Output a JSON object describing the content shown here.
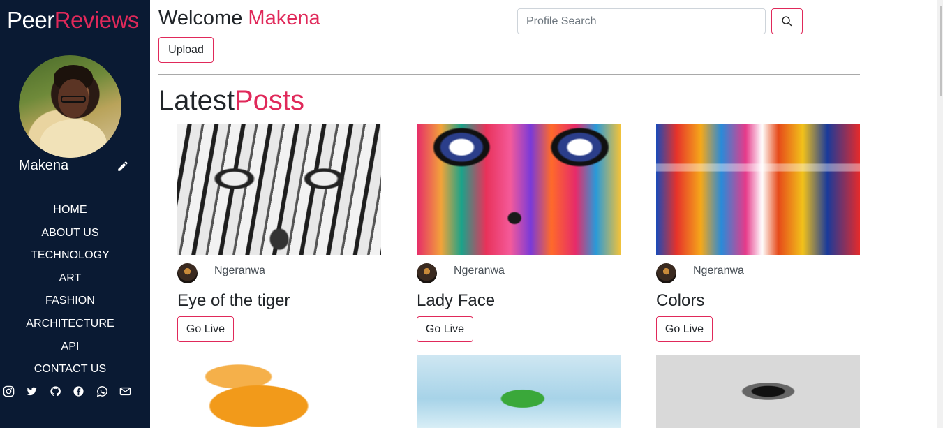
{
  "sidebar": {
    "brand_prefix": "Peer",
    "brand_accent": "Reviews",
    "username": "Makena",
    "nav": [
      "HOME",
      "ABOUT US",
      "TECHNOLOGY",
      "ART",
      "FASHION",
      "ARCHITECTURE",
      "API",
      "CONTACT US"
    ],
    "social_icons": [
      "instagram-icon",
      "twitter-icon",
      "github-icon",
      "facebook-icon",
      "whatsapp-icon",
      "mail-icon"
    ]
  },
  "header": {
    "welcome_prefix": "Welcome",
    "welcome_name": "Makena",
    "upload_label": "Upload",
    "search_placeholder": "Profile Search"
  },
  "section": {
    "title_prefix": "Latest",
    "title_accent": "Posts"
  },
  "posts": [
    {
      "author": "Ngeranwa",
      "title": "Eye of the tiger",
      "button": "Go Live"
    },
    {
      "author": "Ngeranwa",
      "title": "Lady Face",
      "button": "Go Live"
    },
    {
      "author": "Ngeranwa",
      "title": "Colors",
      "button": "Go Live"
    }
  ],
  "colors": {
    "accent": "#e0295a",
    "sidebar_bg": "#0a1a33"
  }
}
